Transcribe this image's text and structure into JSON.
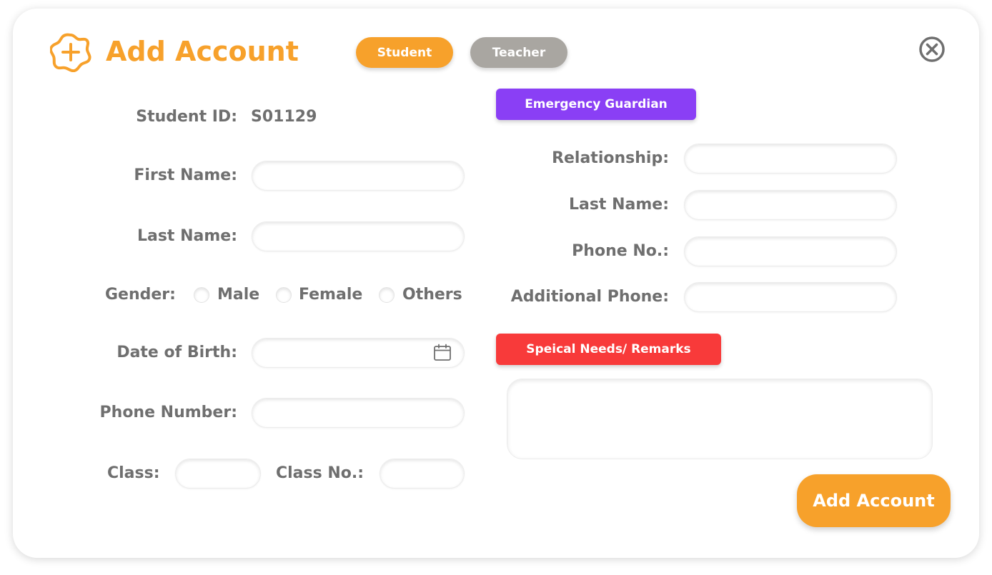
{
  "header": {
    "title": "Add Account",
    "tabs": {
      "student": "Student",
      "teacher": "Teacher"
    }
  },
  "student": {
    "id_label": "Student ID:",
    "id_value": "S01129",
    "first_name_label": "First Name:",
    "first_name_value": "",
    "last_name_label": "Last Name:",
    "last_name_value": "",
    "gender_label": "Gender:",
    "gender_options": [
      "Male",
      "Female",
      "Others"
    ],
    "dob_label": "Date of Birth:",
    "dob_value": "",
    "phone_label": "Phone Number:",
    "phone_value": "",
    "class_label": "Class:",
    "class_value": "",
    "class_no_label": "Class No.:",
    "class_no_value": ""
  },
  "guardian": {
    "section_title": "Emergency Guardian",
    "relationship_label": "Relationship:",
    "relationship_value": "",
    "last_name_label": "Last Name:",
    "last_name_value": "",
    "phone_label": "Phone No.:",
    "phone_value": "",
    "additional_phone_label": "Additional Phone:",
    "additional_phone_value": ""
  },
  "remarks": {
    "section_title": "Speical Needs/ Remarks",
    "value": ""
  },
  "actions": {
    "submit": "Add Account"
  },
  "colors": {
    "accent": "#F7A12B",
    "tab_inactive": "#A9A6A1",
    "guardian_section": "#8A3FF5",
    "remarks_section": "#F83A3A",
    "label_text": "#6f6f6f"
  },
  "icons": {
    "title": "add-circle-icon",
    "close": "close-circle-icon",
    "calendar": "calendar-icon"
  }
}
